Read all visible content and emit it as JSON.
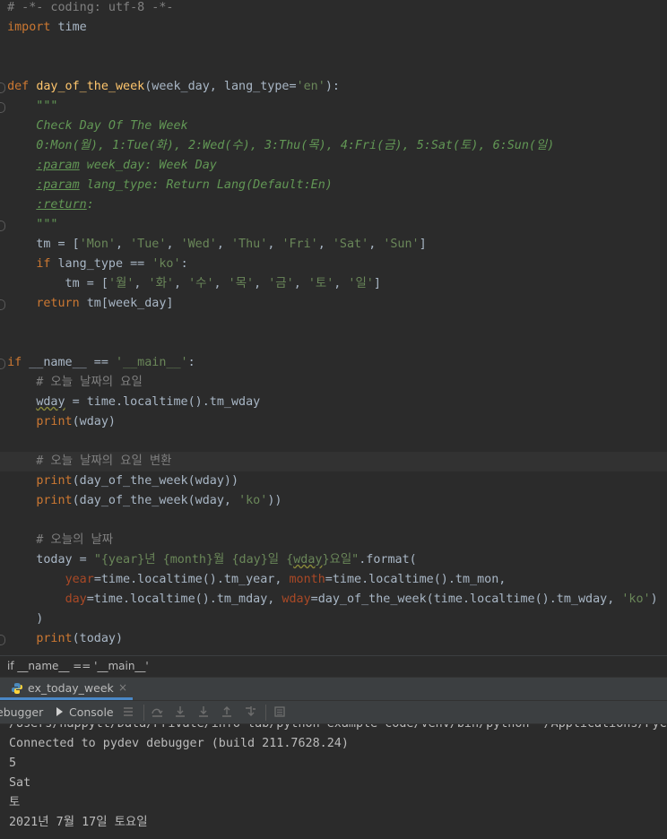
{
  "editor": {
    "lines": [
      {
        "segments": [
          {
            "t": "# -*- coding: utf-8 -*-",
            "c": "c"
          }
        ]
      },
      {
        "segments": [
          {
            "t": "import",
            "c": "k"
          },
          {
            "t": " time",
            "c": ""
          }
        ]
      },
      {
        "segments": []
      },
      {
        "segments": []
      },
      {
        "fold": true,
        "segments": [
          {
            "t": "def",
            "c": "k"
          },
          {
            "t": " ",
            "c": ""
          },
          {
            "t": "day_of_the_week",
            "c": "f"
          },
          {
            "t": "(week_day, lang_type=",
            "c": ""
          },
          {
            "t": "'en'",
            "c": "s"
          },
          {
            "t": "):",
            "c": ""
          }
        ]
      },
      {
        "fold": true,
        "segments": [
          {
            "t": "    \"\"\"",
            "c": "d"
          }
        ]
      },
      {
        "segments": [
          {
            "t": "    Check Day Of The Week",
            "c": "d"
          }
        ]
      },
      {
        "segments": [
          {
            "t": "    0:Mon(월), 1:Tue(화), 2:Wed(수), 3:Thu(목), 4:Fri(금), 5:Sat(토), 6:Sun(일)",
            "c": "d"
          }
        ]
      },
      {
        "segments": [
          {
            "t": "    ",
            "c": "d"
          },
          {
            "t": ":param",
            "c": "d u"
          },
          {
            "t": " week_day: Week Day",
            "c": "d"
          }
        ]
      },
      {
        "segments": [
          {
            "t": "    ",
            "c": "d"
          },
          {
            "t": ":param",
            "c": "d u"
          },
          {
            "t": " lang_type: Return Lang(Default:En)",
            "c": "d"
          }
        ]
      },
      {
        "segments": [
          {
            "t": "    ",
            "c": "d"
          },
          {
            "t": ":return",
            "c": "d u"
          },
          {
            "t": ":",
            "c": "d"
          }
        ]
      },
      {
        "fold": true,
        "segments": [
          {
            "t": "    \"\"\"",
            "c": "d"
          }
        ]
      },
      {
        "segments": [
          {
            "t": "    tm = [",
            "c": ""
          },
          {
            "t": "'Mon'",
            "c": "s"
          },
          {
            "t": ", ",
            "c": ""
          },
          {
            "t": "'Tue'",
            "c": "s"
          },
          {
            "t": ", ",
            "c": ""
          },
          {
            "t": "'Wed'",
            "c": "s"
          },
          {
            "t": ", ",
            "c": ""
          },
          {
            "t": "'Thu'",
            "c": "s"
          },
          {
            "t": ", ",
            "c": ""
          },
          {
            "t": "'Fri'",
            "c": "s"
          },
          {
            "t": ", ",
            "c": ""
          },
          {
            "t": "'Sat'",
            "c": "s"
          },
          {
            "t": ", ",
            "c": ""
          },
          {
            "t": "'Sun'",
            "c": "s"
          },
          {
            "t": "]",
            "c": ""
          }
        ]
      },
      {
        "segments": [
          {
            "t": "    ",
            "c": ""
          },
          {
            "t": "if",
            "c": "k"
          },
          {
            "t": " lang_type == ",
            "c": ""
          },
          {
            "t": "'ko'",
            "c": "s"
          },
          {
            "t": ":",
            "c": ""
          }
        ]
      },
      {
        "segments": [
          {
            "t": "        tm = [",
            "c": ""
          },
          {
            "t": "'월'",
            "c": "s"
          },
          {
            "t": ", ",
            "c": ""
          },
          {
            "t": "'화'",
            "c": "s"
          },
          {
            "t": ", ",
            "c": ""
          },
          {
            "t": "'수'",
            "c": "s"
          },
          {
            "t": ", ",
            "c": ""
          },
          {
            "t": "'목'",
            "c": "s"
          },
          {
            "t": ", ",
            "c": ""
          },
          {
            "t": "'금'",
            "c": "s"
          },
          {
            "t": ", ",
            "c": ""
          },
          {
            "t": "'토'",
            "c": "s"
          },
          {
            "t": ", ",
            "c": ""
          },
          {
            "t": "'일'",
            "c": "s"
          },
          {
            "t": "]",
            "c": ""
          }
        ]
      },
      {
        "fold": true,
        "segments": [
          {
            "t": "    ",
            "c": ""
          },
          {
            "t": "return",
            "c": "k"
          },
          {
            "t": " tm[week_day]",
            "c": ""
          }
        ]
      },
      {
        "segments": []
      },
      {
        "segments": []
      },
      {
        "fold": true,
        "segments": [
          {
            "t": "if",
            "c": "k"
          },
          {
            "t": " __name__ == ",
            "c": ""
          },
          {
            "t": "'__main__'",
            "c": "s"
          },
          {
            "t": ":",
            "c": ""
          }
        ]
      },
      {
        "segments": [
          {
            "t": "    # 오늘 날짜의 요일",
            "c": "c"
          }
        ]
      },
      {
        "segments": [
          {
            "t": "    ",
            "c": ""
          },
          {
            "t": "wday",
            "c": "w"
          },
          {
            "t": " = time.localtime().tm_wday",
            "c": ""
          }
        ]
      },
      {
        "segments": [
          {
            "t": "    ",
            "c": ""
          },
          {
            "t": "print",
            "c": "k"
          },
          {
            "t": "(wday)",
            "c": ""
          }
        ]
      },
      {
        "segments": []
      },
      {
        "hl": true,
        "segments": [
          {
            "t": "    # 오늘 날짜의 요일 변환",
            "c": "c"
          }
        ]
      },
      {
        "segments": [
          {
            "t": "    ",
            "c": ""
          },
          {
            "t": "print",
            "c": "k"
          },
          {
            "t": "(day_of_the_week(wday))",
            "c": ""
          }
        ]
      },
      {
        "segments": [
          {
            "t": "    ",
            "c": ""
          },
          {
            "t": "print",
            "c": "k"
          },
          {
            "t": "(day_of_the_week(wday, ",
            "c": ""
          },
          {
            "t": "'ko'",
            "c": "s"
          },
          {
            "t": "))",
            "c": ""
          }
        ]
      },
      {
        "segments": []
      },
      {
        "segments": [
          {
            "t": "    # 오늘의 날짜",
            "c": "c"
          }
        ]
      },
      {
        "segments": [
          {
            "t": "    today = ",
            "c": ""
          },
          {
            "t": "\"{year}년 {month}월 {day}일 {",
            "c": "s"
          },
          {
            "t": "wday",
            "c": "s w"
          },
          {
            "t": "}요일\"",
            "c": "s"
          },
          {
            "t": ".format(",
            "c": ""
          }
        ]
      },
      {
        "segments": [
          {
            "t": "        ",
            "c": ""
          },
          {
            "t": "year",
            "c": "p"
          },
          {
            "t": "=time.localtime().tm_year, ",
            "c": ""
          },
          {
            "t": "month",
            "c": "p"
          },
          {
            "t": "=time.localtime().tm_mon,",
            "c": ""
          }
        ]
      },
      {
        "segments": [
          {
            "t": "        ",
            "c": ""
          },
          {
            "t": "day",
            "c": "p"
          },
          {
            "t": "=time.localtime().tm_mday, ",
            "c": ""
          },
          {
            "t": "wday",
            "c": "p"
          },
          {
            "t": "=day_of_the_week(time.localtime().tm_wday, ",
            "c": ""
          },
          {
            "t": "'ko'",
            "c": "s"
          },
          {
            "t": ")",
            "c": ""
          }
        ]
      },
      {
        "segments": [
          {
            "t": "    )",
            "c": ""
          }
        ]
      },
      {
        "fold": true,
        "segments": [
          {
            "t": "    ",
            "c": ""
          },
          {
            "t": "print",
            "c": "k"
          },
          {
            "t": "(today)",
            "c": ""
          }
        ]
      }
    ]
  },
  "breadcrumb": {
    "label": "if __name__ == '__main__'"
  },
  "run_tab": {
    "label": "ex_today_week",
    "close": "×"
  },
  "toolbar": {
    "debugger_label": "ebugger",
    "console_label": "Console"
  },
  "console": {
    "lines": [
      "/Users/happytt/Data/Private/info-lab/python-example-code/venv/bin/python \"/Applications/PyC",
      "Connected to pydev debugger (build 211.7628.24)",
      "5",
      "Sat",
      "토",
      "2021년 7월 17일 토요일"
    ]
  }
}
